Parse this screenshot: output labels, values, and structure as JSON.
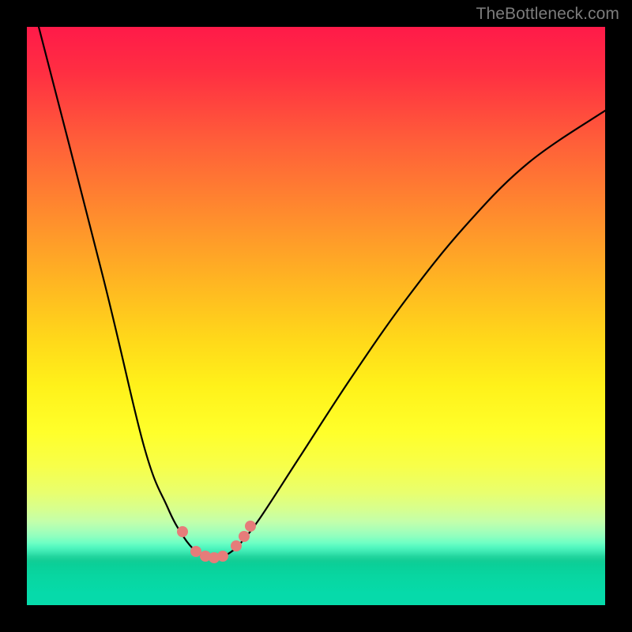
{
  "watermark": "TheBottleneck.com",
  "colors": {
    "curve_stroke": "#000000",
    "marker_fill": "#e67c7a",
    "background_black": "#000000"
  },
  "chart_data": {
    "type": "line",
    "title": "",
    "xlabel": "",
    "ylabel": "",
    "xlim": [
      0,
      1
    ],
    "ylim": [
      0,
      1
    ],
    "x_min_point": 0.32,
    "series": [
      {
        "name": "bottleneck-curve",
        "control_points_svg": [
          [
            0,
            -58
          ],
          [
            96,
            315
          ],
          [
            148,
            530
          ],
          [
            178,
            608
          ],
          [
            198,
            645
          ],
          [
            214,
            664
          ],
          [
            224,
            670
          ],
          [
            232,
            672.5
          ],
          [
            240,
            672.5
          ],
          [
            249,
            670
          ],
          [
            258,
            665
          ],
          [
            271,
            653
          ],
          [
            295,
            622
          ],
          [
            345,
            545
          ],
          [
            410,
            445
          ],
          [
            480,
            345
          ],
          [
            555,
            252
          ],
          [
            635,
            172
          ],
          [
            732,
            106
          ]
        ]
      }
    ],
    "markers": [
      {
        "x_svg": 197,
        "y_svg": 639,
        "r": 7
      },
      {
        "x_svg": 214,
        "y_svg": 664,
        "r": 7
      },
      {
        "x_svg": 226,
        "y_svg": 670,
        "r": 7
      },
      {
        "x_svg": 237,
        "y_svg": 672,
        "r": 7
      },
      {
        "x_svg": 248,
        "y_svg": 670,
        "r": 7
      },
      {
        "x_svg": 265,
        "y_svg": 657,
        "r": 7
      },
      {
        "x_svg": 275,
        "y_svg": 645,
        "r": 7
      },
      {
        "x_svg": 283,
        "y_svg": 632,
        "r": 7
      }
    ]
  }
}
